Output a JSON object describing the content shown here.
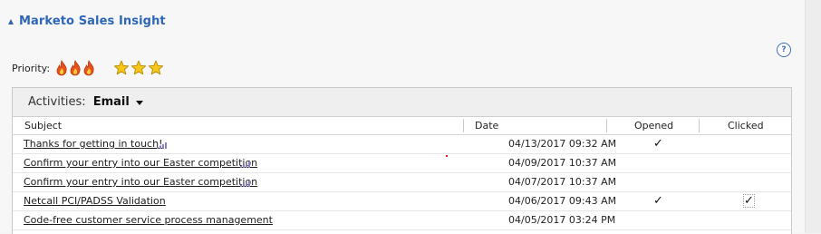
{
  "section": {
    "title": "Marketo Sales Insight",
    "help_label": "?"
  },
  "priority": {
    "label": "Priority:",
    "flames": 3,
    "stars": 3
  },
  "activities": {
    "label": "Activities:",
    "view": "Email",
    "columns": {
      "subject": "Subject",
      "date": "Date",
      "opened": "Opened",
      "clicked": "Clicked"
    },
    "rows": [
      {
        "subject": "Thanks for getting in touch!",
        "date": "04/13/2017 09:32 AM",
        "opened": "✓",
        "clicked": ""
      },
      {
        "subject": "Confirm your entry into our Easter competition",
        "date": "04/09/2017 10:37 AM",
        "opened": "",
        "clicked": ""
      },
      {
        "subject": "Confirm your entry into our Easter competition",
        "date": "04/07/2017 10:37 AM",
        "opened": "",
        "clicked": ""
      },
      {
        "subject": "Netcall PCI/PADSS Validation",
        "date": "04/06/2017 09:43 AM",
        "opened": "✓",
        "clicked": "✓"
      },
      {
        "subject": "Code-free customer service process management",
        "date": "04/05/2017 03:24 PM",
        "opened": "",
        "clicked": ""
      }
    ]
  },
  "colors": {
    "accent": "#2e66b7",
    "flame": "#e8531c",
    "star": "#f5c518"
  }
}
